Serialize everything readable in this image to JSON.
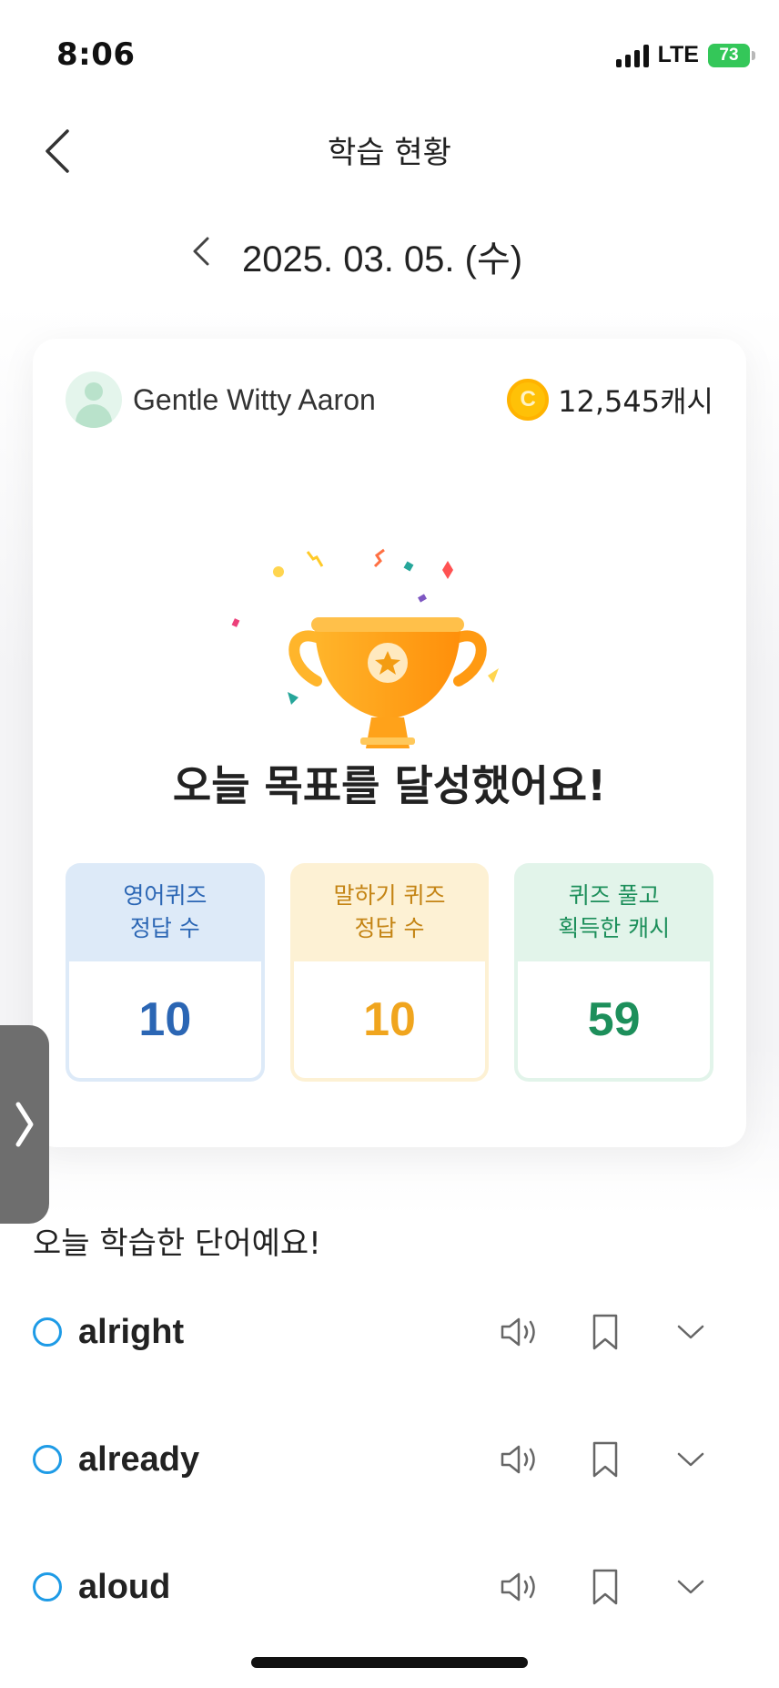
{
  "status_bar": {
    "time": "8:06",
    "network": "LTE",
    "battery": "73"
  },
  "header": {
    "title": "학습 현황"
  },
  "date_nav": {
    "date": "2025. 03. 05. (수)"
  },
  "profile": {
    "name": "Gentle Witty Aaron",
    "cash": "12,545캐시",
    "coin_symbol": "C"
  },
  "achievement": {
    "message": "오늘 목표를 달성했어요!"
  },
  "stats": [
    {
      "label": "영어퀴즈\n정답 수",
      "value": "10",
      "color": "#2b66b4"
    },
    {
      "label": "말하기 퀴즈\n정답 수",
      "value": "10",
      "color": "#f0a51e"
    },
    {
      "label": "퀴즈 풀고\n획득한 캐시",
      "value": "59",
      "color": "#1d8f5b"
    }
  ],
  "words_section": {
    "title": "오늘 학습한 단어예요!",
    "words": [
      {
        "word": "alright"
      },
      {
        "word": "already"
      },
      {
        "word": "aloud"
      }
    ]
  },
  "icons": {
    "back": "chevron-left-icon",
    "date_prev": "chevron-left-icon",
    "speaker": "speaker-icon",
    "bookmark": "bookmark-icon",
    "expand": "chevron-down-icon",
    "side_tab": "chevron-right-icon"
  },
  "colors": {
    "accent_blue": "#1e9be6",
    "coin": "#ffc107"
  }
}
